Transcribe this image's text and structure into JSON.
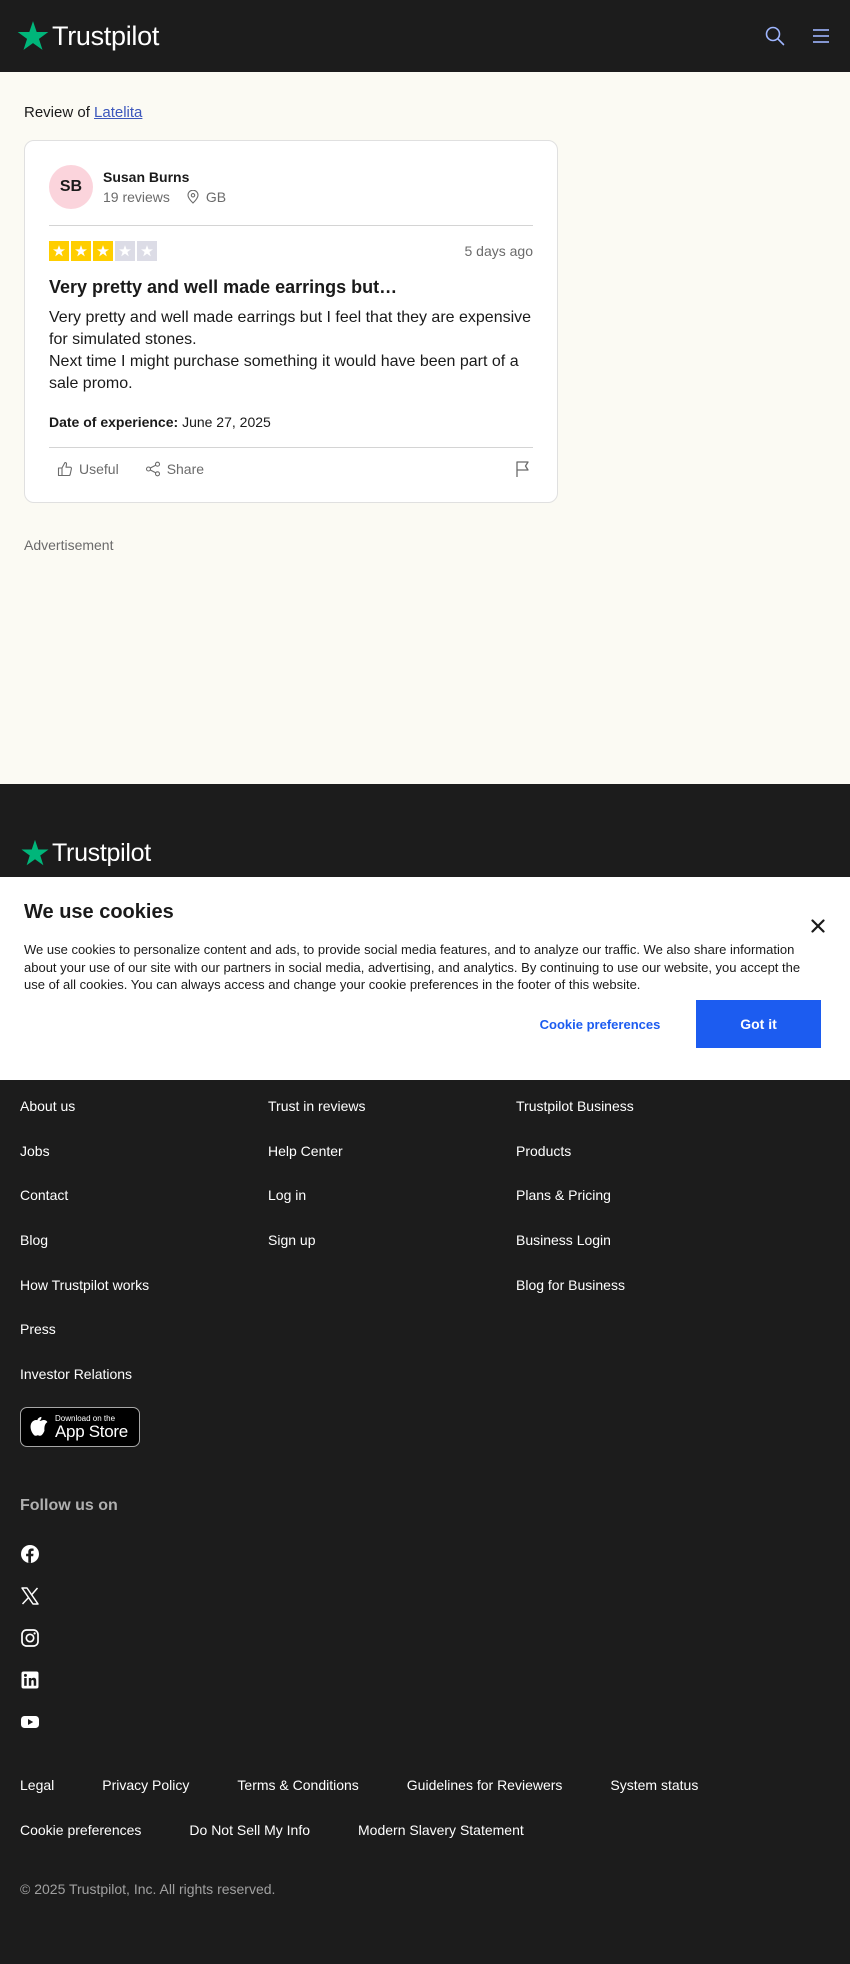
{
  "header": {
    "logo_text": "Trustpilot",
    "icons": [
      "search-icon",
      "menu-icon"
    ]
  },
  "review_page": {
    "review_of_prefix": "Review of",
    "business_name": "Latelita",
    "reviewer": {
      "initials": "SB",
      "name": "Susan Burns",
      "reviews_count": "19 reviews",
      "location": "GB"
    },
    "rating": 3,
    "max_rating": 5,
    "date_ago": "5 days ago",
    "title": "Very pretty and well made earrings but…",
    "body": [
      "Very pretty and well made earrings but I feel that they are expensive for simulated stones.",
      "Next time I might purchase something it would have been part of a sale promo."
    ],
    "experience_label": "Date of experience:",
    "experience_date": "June 27, 2025",
    "actions": {
      "useful_label": "Useful",
      "share_label": "Share"
    },
    "advertisement_label": "Advertisement"
  },
  "cookie_banner": {
    "title": "We use cookies",
    "text": "We use cookies to personalize content and ads, to provide social media features, and to analyze our traffic. We also share information about your use of our site with our partners in social media, advertising, and analytics. By continuing to use our website, you accept the use of all cookies. You can always access and change your cookie preferences in the footer of this website.",
    "preferences_label": "Cookie preferences",
    "accept_label": "Got it"
  },
  "footer": {
    "logo_text": "Trustpilot",
    "col1": [
      "About us",
      "Jobs",
      "Contact",
      "Blog",
      "How Trustpilot works",
      "Press",
      "Investor Relations"
    ],
    "col2": [
      "Trust in reviews",
      "Help Center",
      "Log in",
      "Sign up"
    ],
    "col3": [
      "Trustpilot Business",
      "Products",
      "Plans & Pricing",
      "Business Login",
      "Blog for Business"
    ],
    "app_store": {
      "small": "Download on the",
      "big": "App Store"
    },
    "follow_label": "Follow us on",
    "social_icons": [
      "facebook-icon",
      "x-icon",
      "instagram-icon",
      "linkedin-icon",
      "youtube-icon"
    ],
    "legal_row1": [
      "Legal",
      "Privacy Policy",
      "Terms & Conditions",
      "Guidelines for Reviewers",
      "System status"
    ],
    "legal_row2": [
      "Cookie preferences",
      "Do Not Sell My Info",
      "Modern Slavery Statement"
    ],
    "copyright": "© 2025 Trustpilot, Inc. All rights reserved."
  },
  "colors": {
    "brand_green": "#00b67a",
    "star_yellow": "#ffce00",
    "link_blue": "#3c57bc",
    "cta_blue": "#1c5cf0",
    "dark_bg": "#1c1c1c",
    "page_bg": "#fbfaf3"
  }
}
